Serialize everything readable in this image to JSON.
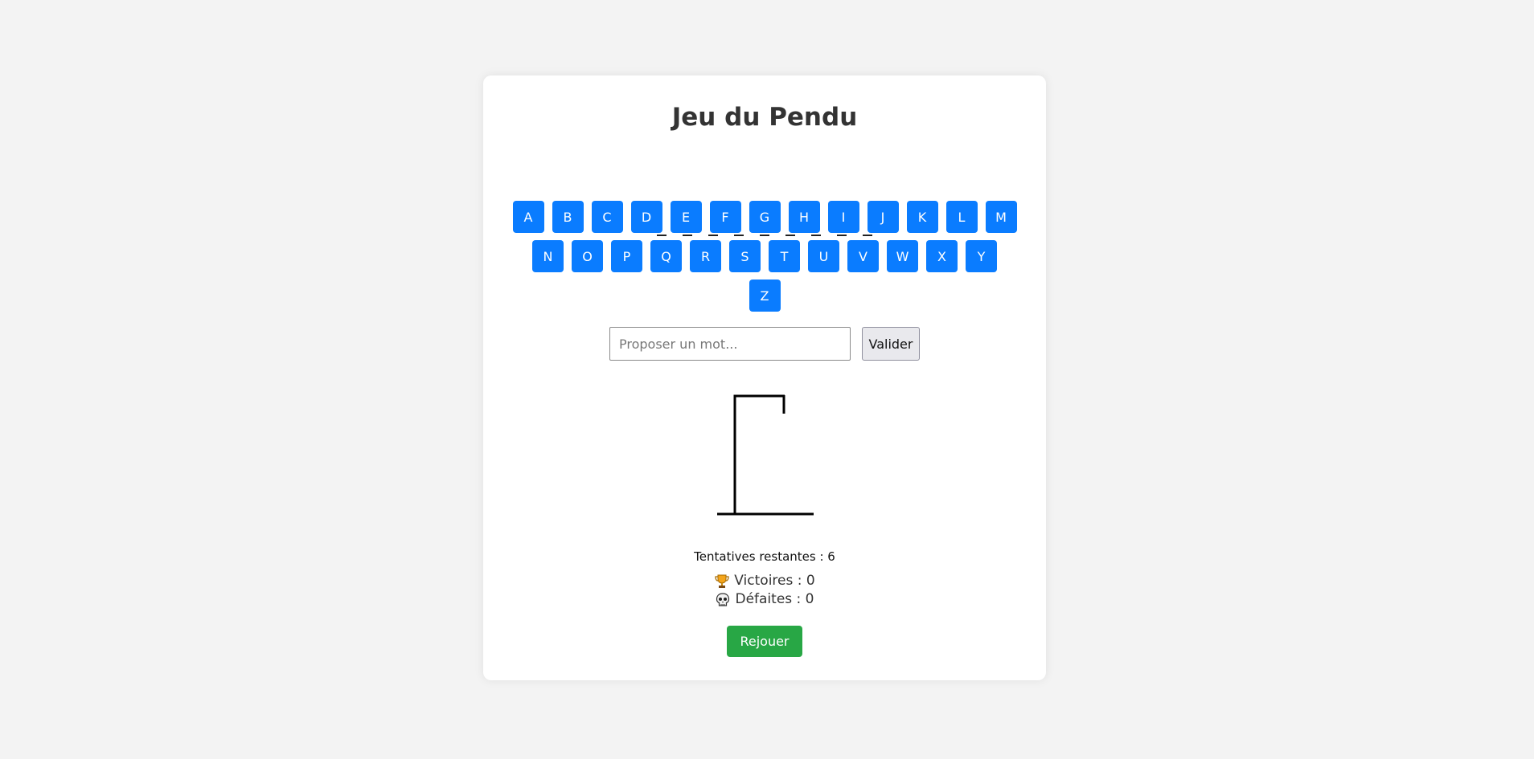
{
  "game": {
    "title": "Jeu du Pendu",
    "word_length": 9,
    "keyboard": {
      "row1": [
        "A",
        "B",
        "C",
        "D",
        "E",
        "F",
        "G",
        "H",
        "I",
        "J",
        "K",
        "L",
        "M"
      ],
      "row2": [
        "N",
        "O",
        "P",
        "Q",
        "R",
        "S",
        "T",
        "U",
        "V",
        "W",
        "X",
        "Y"
      ],
      "row3": [
        "Z"
      ]
    },
    "guess_input": {
      "placeholder": "Proposer un mot...",
      "value": ""
    },
    "validate_label": "Valider",
    "attempts_text": "Tentatives restantes : 6",
    "attempts_remaining": 6,
    "stats": {
      "wins_icon": "trophy-icon",
      "wins_text": "Victoires : 0",
      "losses_icon": "skull-icon",
      "losses_text": "Défaites : 0"
    },
    "replay_label": "Rejouer"
  },
  "colors": {
    "key_blue": "#0a7cff",
    "replay_green": "#28a745",
    "background": "#f3f3f3"
  }
}
